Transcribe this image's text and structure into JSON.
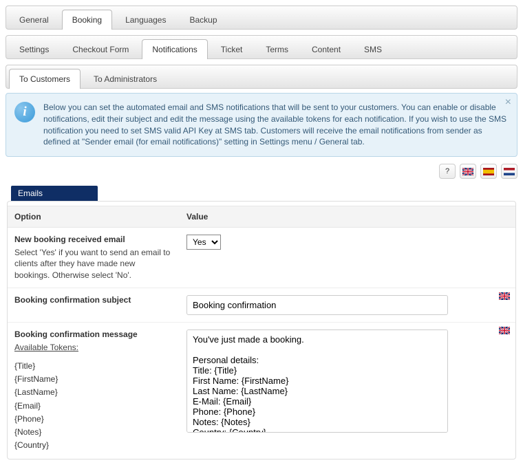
{
  "tabs_top": [
    {
      "label": "General"
    },
    {
      "label": "Booking"
    },
    {
      "label": "Languages"
    },
    {
      "label": "Backup"
    }
  ],
  "tabs_top_active": 1,
  "tabs_mid": [
    {
      "label": "Settings"
    },
    {
      "label": "Checkout Form"
    },
    {
      "label": "Notifications"
    },
    {
      "label": "Ticket"
    },
    {
      "label": "Terms"
    },
    {
      "label": "Content"
    },
    {
      "label": "SMS"
    }
  ],
  "tabs_mid_active": 2,
  "tabs_inner": [
    {
      "label": "To Customers"
    },
    {
      "label": "To Administrators"
    }
  ],
  "tabs_inner_active": 0,
  "info_text": "Below you can set the automated email and SMS notifications that will be sent to your customers. You can enable or disable notifications, edit their subject and edit the message using the available tokens for each notification. If you wish to use the SMS notification you need to set SMS valid API Key at SMS tab. Customers will receive the email notifications from sender as defined at \"Sender email (for email notifications)\" setting in Settings menu / General tab.",
  "help_label": "?",
  "panel_title": "Emails",
  "headers": {
    "option": "Option",
    "value": "Value"
  },
  "row1": {
    "title": "New booking received email",
    "desc": "Select 'Yes' if you want to send an email to clients after they have made new bookings. Otherwise select 'No'.",
    "selected": "Yes"
  },
  "row2": {
    "title": "Booking confirmation subject",
    "value": "Booking confirmation"
  },
  "row3": {
    "title": "Booking confirmation message",
    "sub": "Available Tokens:",
    "tokens": [
      "{Title}",
      "{FirstName}",
      "{LastName}",
      "{Email}",
      "{Phone}",
      "{Notes}",
      "{Country}"
    ],
    "value": "You've just made a booking.\n\nPersonal details:\nTitle: {Title}\nFirst Name: {FirstName}\nLast Name: {LastName}\nE-Mail: {Email}\nPhone: {Phone}\nNotes: {Notes}\nCountry: {Country}\nCity: {City}"
  }
}
